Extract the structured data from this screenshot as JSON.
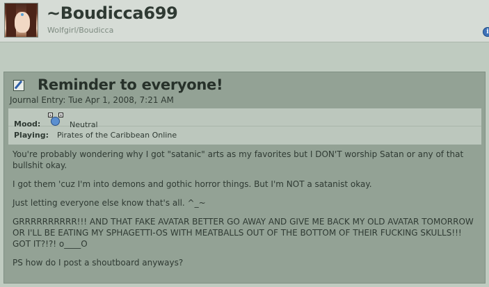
{
  "profile": {
    "username": "~Boudicca699",
    "subtitle": "Wolfgirl/Boudicca",
    "info_icon": "i"
  },
  "journal": {
    "title": "Reminder to everyone!",
    "date": "Journal Entry: Tue Apr 1, 2008, 7:21 AM",
    "mood_label": "Mood:",
    "mood_value": "Neutral",
    "playing_label": "Playing:",
    "playing_value": "Pirates of the Caribbean Online",
    "paragraphs": [
      "You're probably wondering why I got \"satanic\" arts as my favorites but I DON'T worship Satan or any of that bullshit okay.",
      "I got them 'cuz I'm into demons and gothic horror things. But I'm NOT a satanist okay.",
      "Just letting everyone else know that's all. ^_~",
      "GRRRRRRRRRR!!! AND THAT FAKE AVATAR BETTER GO AWAY AND GIVE ME BACK MY OLD AVATAR TOMORROW OR I'LL BE EATING MY SPHAGETTI-OS WITH MEATBALLS OUT OF THE BOTTOM OF THEIR FUCKING SKULLS!!! GOT IT?!?! o____O",
      "PS how do I post a shoutboard anyways?"
    ]
  },
  "icons": {
    "avatar": "avatar-image",
    "info": "info-icon",
    "journal": "journal-pencil-icon",
    "mood": "neutral-mood-icon"
  }
}
